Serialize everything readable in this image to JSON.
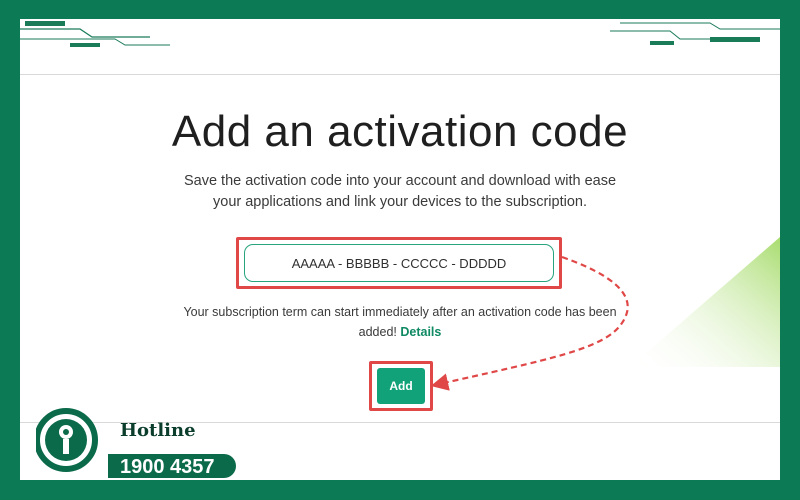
{
  "page": {
    "title": "Add an activation code",
    "description": "Save the activation code into your account and download with ease your applications and link your devices to the subscription.",
    "code_value": "AAAAA - BBBBB - CCCCC - DDDDD",
    "term_text": "Your subscription term can start immediately after an activation code has been added! ",
    "details_link": "Details",
    "add_button": "Add"
  },
  "hotline": {
    "label": "Hotline",
    "number": "1900 4357"
  },
  "colors": {
    "brand_green": "#0b7a55",
    "button_green": "#12a27a",
    "highlight_red": "#e04848"
  },
  "icons": [
    "phone-icon",
    "dashed-arrow-icon"
  ]
}
